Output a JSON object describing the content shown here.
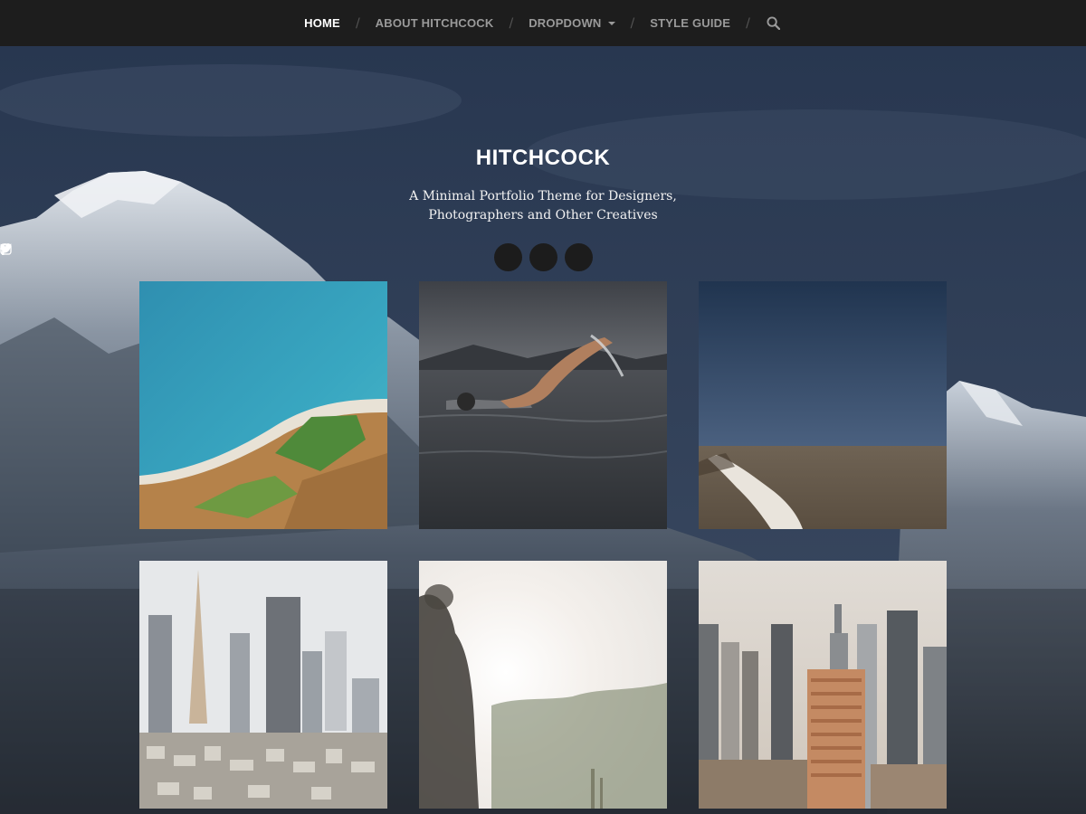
{
  "nav": {
    "items": [
      {
        "label": "HOME",
        "active": true
      },
      {
        "label": "ABOUT HITCHCOCK",
        "active": false
      },
      {
        "label": "DROPDOWN",
        "active": false
      },
      {
        "label": "STYLE GUIDE",
        "active": false
      }
    ],
    "separator": "/",
    "search_icon": "search-icon"
  },
  "header": {
    "title": "HITCHCOCK",
    "description": "A Minimal Portfolio Theme for Designers, Photographers and Other Creatives"
  },
  "social": [
    "twitter-icon",
    "facebook-icon",
    "instagram-icon"
  ],
  "colors": {
    "nav_bg": "#1d1d1d",
    "nav_text": "#9a9a9a",
    "nav_active": "#ffffff",
    "social_bg": "#1c1c1c"
  }
}
